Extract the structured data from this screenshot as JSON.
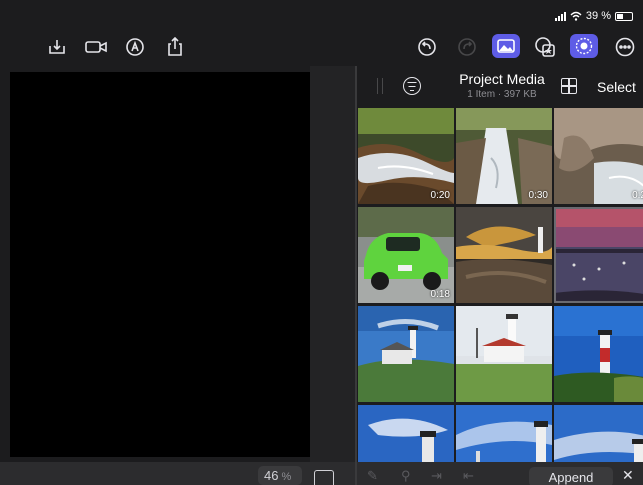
{
  "status": {
    "battery_text": "39 %"
  },
  "toolbar": {
    "left_icons": [
      "import-icon",
      "camera-icon",
      "voiceover-icon",
      "share-icon"
    ],
    "right_icons": [
      "undo-icon",
      "redo-icon",
      "photos-icon",
      "favorites-icon",
      "inspector-icon",
      "more-icon"
    ]
  },
  "viewer": {
    "zoom_value": "46",
    "zoom_unit": "%"
  },
  "media": {
    "title": "Project Media",
    "subtitle": "1 Item  ·  397 KB",
    "select_label": "Select",
    "thumbnails": [
      {
        "kind": "stream-1",
        "duration": "0:20"
      },
      {
        "kind": "stream-2",
        "duration": "0:30"
      },
      {
        "kind": "stream-3",
        "duration": "0:2"
      },
      {
        "kind": "green-car",
        "duration": "0:18"
      },
      {
        "kind": "sunset-lighthouse",
        "duration": ""
      },
      {
        "kind": "harbor-dusk",
        "duration": ""
      },
      {
        "kind": "lighthouse-cliff",
        "duration": ""
      },
      {
        "kind": "white-lighthouse",
        "duration": ""
      },
      {
        "kind": "red-lighthouse",
        "duration": ""
      },
      {
        "kind": "lighthouse-sky-1",
        "duration": ""
      },
      {
        "kind": "lighthouse-sky-2",
        "duration": ""
      },
      {
        "kind": "lighthouse-sky-3",
        "duration": ""
      }
    ],
    "footer": {
      "append_label": "Append"
    }
  },
  "colors": {
    "accent": "#5e5ce6",
    "background": "#1c1c1e"
  }
}
